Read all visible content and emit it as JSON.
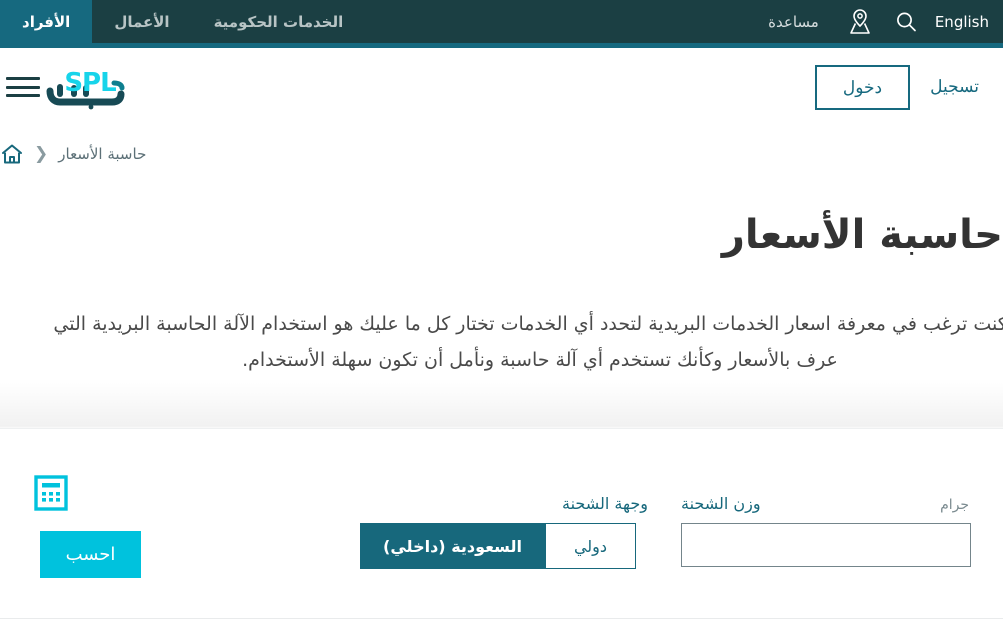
{
  "topbar": {
    "tabs": [
      {
        "label": "الأفراد",
        "active": true
      },
      {
        "label": "الأعمال",
        "active": false
      },
      {
        "label": "الخدمات الحكومية",
        "active": false
      }
    ],
    "help_label": "مساعدة",
    "language_label": "English",
    "location_icon": "map-pin-icon",
    "search_icon": "search-icon",
    "active_tab_color": "#16697f",
    "background_color": "#1b3f43"
  },
  "header": {
    "logo_text_latin": "SPL",
    "logo_text_arabic": "سبل",
    "menu_icon": "hamburger-icon",
    "login_label": "دخول",
    "register_label": "تسجيل"
  },
  "breadcrumb": {
    "home_icon": "home-icon",
    "separator": "❮",
    "current": "حاسبة الأسعار"
  },
  "page": {
    "title": "حاسبة الأسعار",
    "intro_line_1": "ذا كنت ترغب في معرفة اسعار الخدمات البريدية لتحدد أي الخدمات تختار كل ما عليك هو استخدام الآلة الحاسبة البريدية التي",
    "intro_line_2": "عرف بالأسعار وكأنك تستخدم أي آلة حاسبة ونأمل أن تكون سهلة الأستخدام."
  },
  "calculator": {
    "icon": "calculator-icon",
    "calculate_label": "احسب",
    "weight": {
      "label": "وزن الشحنة",
      "unit": "جرام",
      "value": "",
      "placeholder": ""
    },
    "destination": {
      "label": "وجهة الشحنة",
      "options": [
        {
          "label": "السعودية (داخلي)",
          "active": true
        },
        {
          "label": "دولي",
          "active": false
        }
      ]
    },
    "accent_color": "#00c2dd",
    "teal_color": "#17687c"
  }
}
